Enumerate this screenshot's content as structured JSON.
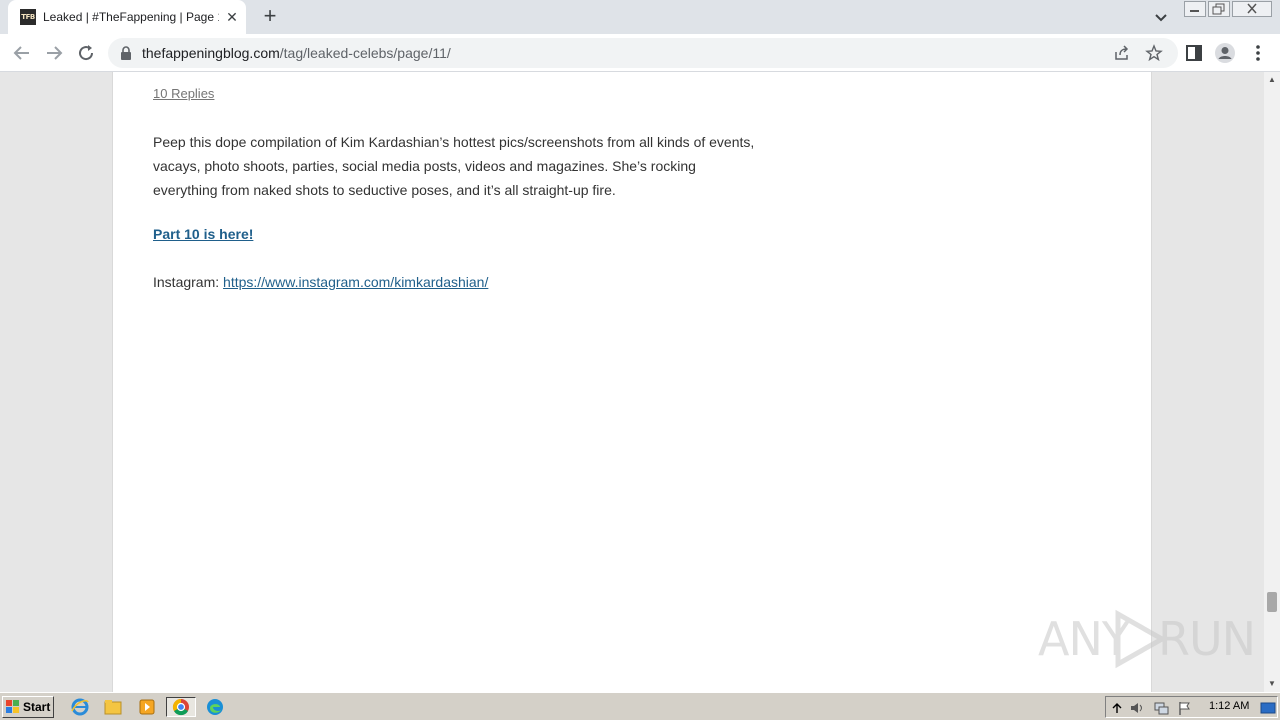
{
  "browser": {
    "tab": {
      "favicon_text": "TFB",
      "title": "Leaked | #TheFappening | Page 11"
    },
    "address": {
      "domain": "thefappeningblog.com",
      "path": "/tag/leaked-celebs/page/11/"
    }
  },
  "article": {
    "replies_link": "10 Replies",
    "paragraph": "Peep this dope compilation of Kim Kardashian’s hottest pics/screenshots from all kinds of events, vacays, photo shoots, parties, social media posts, videos and magazines. She’s rocking everything from naked shots to seductive poses, and it’s all straight-up fire.",
    "part_link": "Part 10 is here!",
    "instagram_label": "Instagram: ",
    "instagram_url": "https://www.instagram.com/kimkardashian/"
  },
  "watermark": {
    "left": "ANY",
    "right": "RUN"
  },
  "taskbar": {
    "start_label": "Start",
    "clock": "1:12 AM"
  },
  "colors": {
    "link": "#1f5f8b",
    "tabstrip": "#dfe3e8",
    "taskbar": "#d4d0c8"
  }
}
